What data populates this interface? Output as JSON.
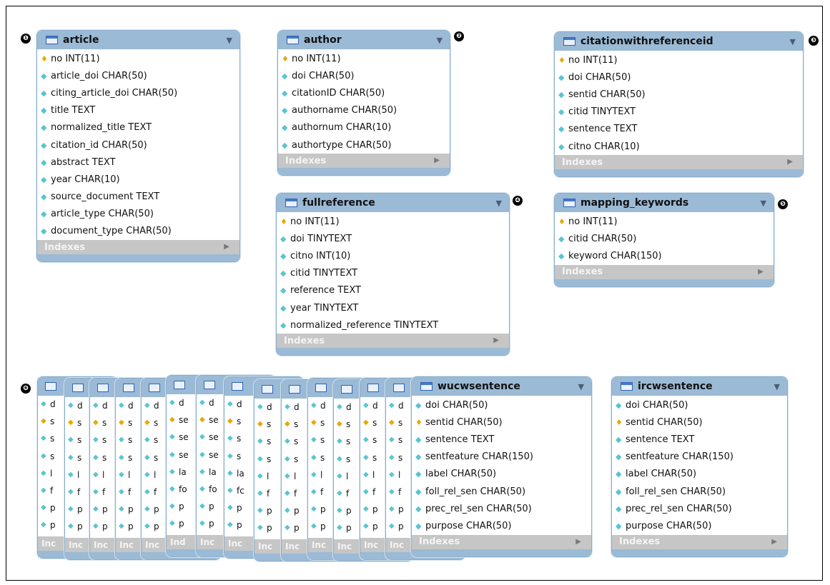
{
  "markers": [
    "❶",
    "❷",
    "❸",
    "❹",
    "❺",
    "❻"
  ],
  "indexes_label": "Indexes",
  "icons": {
    "primary_key": "key-icon",
    "field": "diamond-icon",
    "table": "table-icon",
    "menu": "dropdown-arrow-icon",
    "expand": "play-arrow-icon"
  },
  "colors": {
    "header": "#9bbad6",
    "border": "#8aaecd",
    "indexes_bar": "#c6c6c6",
    "key": "#e8a800",
    "field": "#59c4d3"
  },
  "tables": {
    "article": {
      "name": "article",
      "columns": [
        {
          "text": "no INT(11)",
          "pk": true
        },
        {
          "text": "article_doi CHAR(50)",
          "pk": false
        },
        {
          "text": "citing_article_doi CHAR(50)",
          "pk": false
        },
        {
          "text": "title TEXT",
          "pk": false
        },
        {
          "text": "normalized_title TEXT",
          "pk": false
        },
        {
          "text": "citation_id CHAR(50)",
          "pk": false
        },
        {
          "text": "abstract TEXT",
          "pk": false
        },
        {
          "text": "year CHAR(10)",
          "pk": false
        },
        {
          "text": "source_document TEXT",
          "pk": false
        },
        {
          "text": "article_type CHAR(50)",
          "pk": false
        },
        {
          "text": "document_type CHAR(50)",
          "pk": false
        }
      ]
    },
    "author": {
      "name": "author",
      "columns": [
        {
          "text": "no INT(11)",
          "pk": true
        },
        {
          "text": "doi CHAR(50)",
          "pk": false
        },
        {
          "text": "citationID CHAR(50)",
          "pk": false
        },
        {
          "text": "authorname CHAR(50)",
          "pk": false
        },
        {
          "text": "authornum CHAR(10)",
          "pk": false
        },
        {
          "text": "authortype CHAR(50)",
          "pk": false
        }
      ]
    },
    "citationwithreferenceid": {
      "name": "citationwithreferenceid",
      "columns": [
        {
          "text": "no INT(11)",
          "pk": true
        },
        {
          "text": "doi CHAR(50)",
          "pk": false
        },
        {
          "text": "sentid CHAR(50)",
          "pk": false
        },
        {
          "text": "citid TINYTEXT",
          "pk": false
        },
        {
          "text": "sentence TEXT",
          "pk": false
        },
        {
          "text": "citno CHAR(10)",
          "pk": false
        }
      ]
    },
    "fullreference": {
      "name": "fullreference",
      "columns": [
        {
          "text": "no INT(11)",
          "pk": true
        },
        {
          "text": "doi TINYTEXT",
          "pk": false
        },
        {
          "text": "citno INT(10)",
          "pk": false
        },
        {
          "text": "citid TINYTEXT",
          "pk": false
        },
        {
          "text": "reference TEXT",
          "pk": false
        },
        {
          "text": "year TINYTEXT",
          "pk": false
        },
        {
          "text": "normalized_reference TINYTEXT",
          "pk": false
        }
      ]
    },
    "mapping_keywords": {
      "name": "mapping_keywords",
      "columns": [
        {
          "text": "no INT(11)",
          "pk": true
        },
        {
          "text": "citid CHAR(50)",
          "pk": false
        },
        {
          "text": "keyword CHAR(150)",
          "pk": false
        }
      ]
    },
    "wucwsentence": {
      "name": "wucwsentence",
      "columns": [
        {
          "text": "doi CHAR(50)",
          "pk": false
        },
        {
          "text": "sentid CHAR(50)",
          "pk": true
        },
        {
          "text": "sentence TEXT",
          "pk": false
        },
        {
          "text": "sentfeature CHAR(150)",
          "pk": false
        },
        {
          "text": "label CHAR(50)",
          "pk": false
        },
        {
          "text": "foll_rel_sen CHAR(50)",
          "pk": false
        },
        {
          "text": "prec_rel_sen CHAR(50)",
          "pk": false
        },
        {
          "text": "purpose CHAR(50)",
          "pk": false
        }
      ]
    },
    "ircwsentence": {
      "name": "ircwsentence",
      "columns": [
        {
          "text": "doi CHAR(50)",
          "pk": false
        },
        {
          "text": "sentid CHAR(50)",
          "pk": true
        },
        {
          "text": "sentence TEXT",
          "pk": false
        },
        {
          "text": "sentfeature CHAR(150)",
          "pk": false
        },
        {
          "text": "label CHAR(50)",
          "pk": false
        },
        {
          "text": "foll_rel_sen CHAR(50)",
          "pk": false
        },
        {
          "text": "prec_rel_sen CHAR(50)",
          "pk": false
        },
        {
          "text": "purpose CHAR(50)",
          "pk": false
        }
      ]
    }
  },
  "stacked_cards": [
    {
      "rows": [
        "d",
        "s",
        "s",
        "s",
        "l",
        "f",
        "p",
        "p"
      ],
      "pk_row": 1,
      "idx": "Inc"
    },
    {
      "rows": [
        "d",
        "s",
        "s",
        "s",
        "l",
        "f",
        "p",
        "p"
      ],
      "pk_row": 1,
      "idx": "Inc"
    },
    {
      "rows": [
        "d",
        "s",
        "s",
        "s",
        "l",
        "f",
        "p",
        "p"
      ],
      "pk_row": 1,
      "idx": "Inc"
    },
    {
      "rows": [
        "d",
        "s",
        "s",
        "s",
        "l",
        "f",
        "p",
        "p"
      ],
      "pk_row": 1,
      "idx": "Inc"
    },
    {
      "rows": [
        "d",
        "s",
        "s",
        "s",
        "l",
        "f",
        "p",
        "p"
      ],
      "pk_row": 1,
      "idx": "Inc"
    },
    {
      "rows": [
        "d",
        "se",
        "se",
        "se",
        "la",
        "fo",
        "p",
        "p"
      ],
      "pk_row": 1,
      "idx": "Ind"
    },
    {
      "rows": [
        "d",
        "se",
        "se",
        "se",
        "la",
        "fo",
        "p",
        "p"
      ],
      "pk_row": 1,
      "idx": "Inc"
    },
    {
      "rows": [
        "d",
        "s",
        "s",
        "s",
        "la",
        "fc",
        "p",
        "p"
      ],
      "pk_row": 1,
      "idx": "Inc"
    },
    {
      "rows": [
        "d",
        "s",
        "s",
        "s",
        "l",
        "f",
        "p",
        "p"
      ],
      "pk_row": 1,
      "idx": "Inc"
    },
    {
      "rows": [
        "d",
        "s",
        "s",
        "s",
        "l",
        "f",
        "p",
        "p"
      ],
      "pk_row": 1,
      "idx": "Inc"
    },
    {
      "rows": [
        "d",
        "s",
        "s",
        "s",
        "l",
        "f",
        "p",
        "p"
      ],
      "pk_row": 1,
      "idx": "Inc"
    },
    {
      "rows": [
        "d",
        "s",
        "s",
        "s",
        "l",
        "f",
        "p",
        "p"
      ],
      "pk_row": 1,
      "idx": "Inc"
    },
    {
      "rows": [
        "d",
        "s",
        "s",
        "s",
        "l",
        "f",
        "p",
        "p"
      ],
      "pk_row": 1,
      "idx": "Inc"
    },
    {
      "rows": [
        "d",
        "s",
        "s",
        "s",
        "l",
        "f",
        "p",
        "p"
      ],
      "pk_row": 1,
      "idx": "Inc"
    }
  ]
}
